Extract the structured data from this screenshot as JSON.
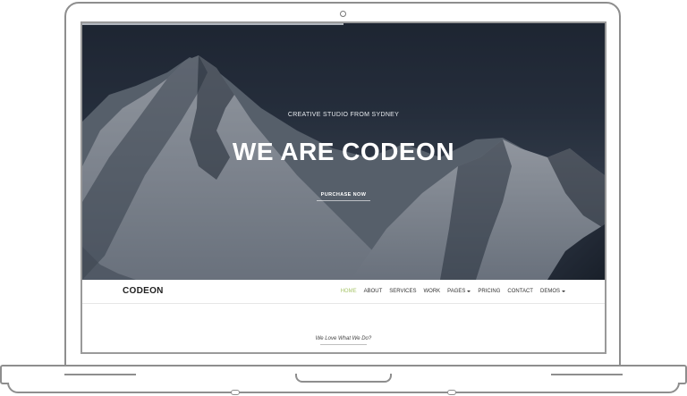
{
  "hero": {
    "subtitle": "CREATIVE STUDIO FROM SYDNEY",
    "title": "WE ARE CODEON",
    "button_label": "PURCHASE NOW",
    "slider_progress": 0.5
  },
  "navbar": {
    "brand": "CODEON",
    "items": [
      {
        "label": "HOME",
        "active": true
      },
      {
        "label": "ABOUT"
      },
      {
        "label": "SERVICES"
      },
      {
        "label": "WORK"
      },
      {
        "label": "PAGES",
        "dropdown": true
      },
      {
        "label": "PRICING"
      },
      {
        "label": "CONTACT"
      },
      {
        "label": "DEMOS",
        "dropdown": true
      }
    ],
    "active_color": "#a8c66c"
  },
  "section": {
    "tagline": "We Love What We Do?"
  }
}
